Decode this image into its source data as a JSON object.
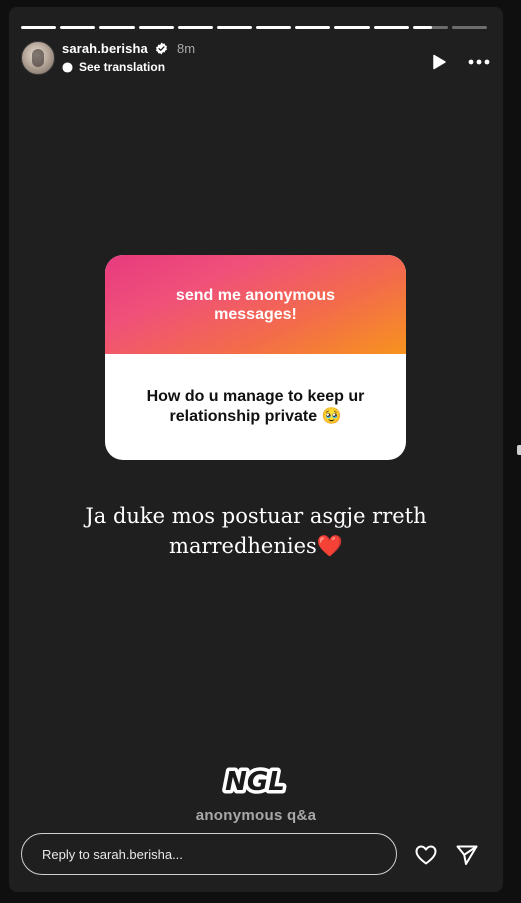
{
  "story": {
    "segments": [
      1,
      1,
      1,
      1,
      1,
      1,
      1,
      1,
      1,
      1,
      0.55,
      0
    ],
    "user": {
      "username": "sarah.berisha",
      "verified": true,
      "time": "8m",
      "translation_label": "See translation"
    },
    "icons": {
      "verified": "verified-badge-icon",
      "translate": "globe-icon",
      "play": "play-icon",
      "more": "more-options-icon",
      "like": "heart-icon",
      "share": "send-icon"
    }
  },
  "question_card": {
    "prompt": "send me anonymous messages!",
    "question": "How do u manage to keep ur relationship private 🥹"
  },
  "caption": "Ja duke mos postuar asgje rreth marredhenies❤️",
  "sticker": {
    "logo_text": "NGL",
    "subtitle": "anonymous q&a"
  },
  "reply": {
    "placeholder": "Reply to sarah.berisha..."
  },
  "colors": {
    "story_bg": "#1f1f1f",
    "gradient_start": "#e73a7e",
    "gradient_end": "#f7931e"
  }
}
